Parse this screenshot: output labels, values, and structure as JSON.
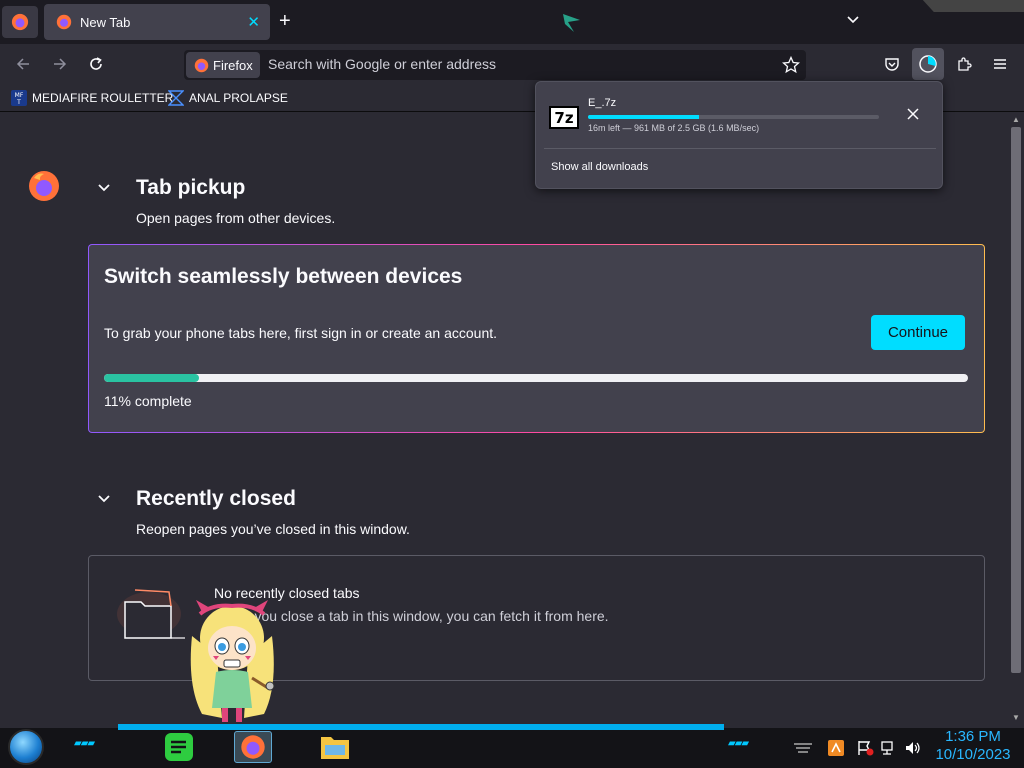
{
  "tabs": [
    {
      "label": "New Tab",
      "active": true
    }
  ],
  "navbar": {
    "identity_label": "Firefox",
    "url_placeholder": "Search with Google or enter address"
  },
  "bookmarks": [
    {
      "label": "MEDIAFIRE ROULETTER",
      "icon": "mediafire-icon"
    },
    {
      "label": "ANAL PROLAPSE",
      "icon": "bookmark-site-icon"
    }
  ],
  "tab_pickup": {
    "title": "Tab pickup",
    "subtitle": "Open pages from other devices.",
    "card_heading": "Switch seamlessly between devices",
    "card_description": "To grab your phone tabs here, first sign in or create an account.",
    "continue_label": "Continue",
    "progress_percent": 11,
    "progress_text": "11% complete"
  },
  "recently_closed": {
    "title": "Recently closed",
    "subtitle": "Reopen pages you’ve closed in this window.",
    "empty_title": "No recently closed tabs",
    "empty_description": "When you close a tab in this window, you can fetch it from here."
  },
  "downloads_panel": {
    "file_name": "E_.7z",
    "file_icon_text": "7z",
    "progress_fraction": 0.38,
    "status": "16m left — 961 MB of 2.5 GB (1.6 MB/sec)",
    "show_all_label": "Show all downloads"
  },
  "taskbar": {
    "time": "1:36 PM",
    "date": "10/10/2023"
  },
  "colors": {
    "accent": "#00ddff",
    "progress_green": "#2ac3a2",
    "page_bg": "#2b2a33",
    "card_bg": "#42414d"
  }
}
